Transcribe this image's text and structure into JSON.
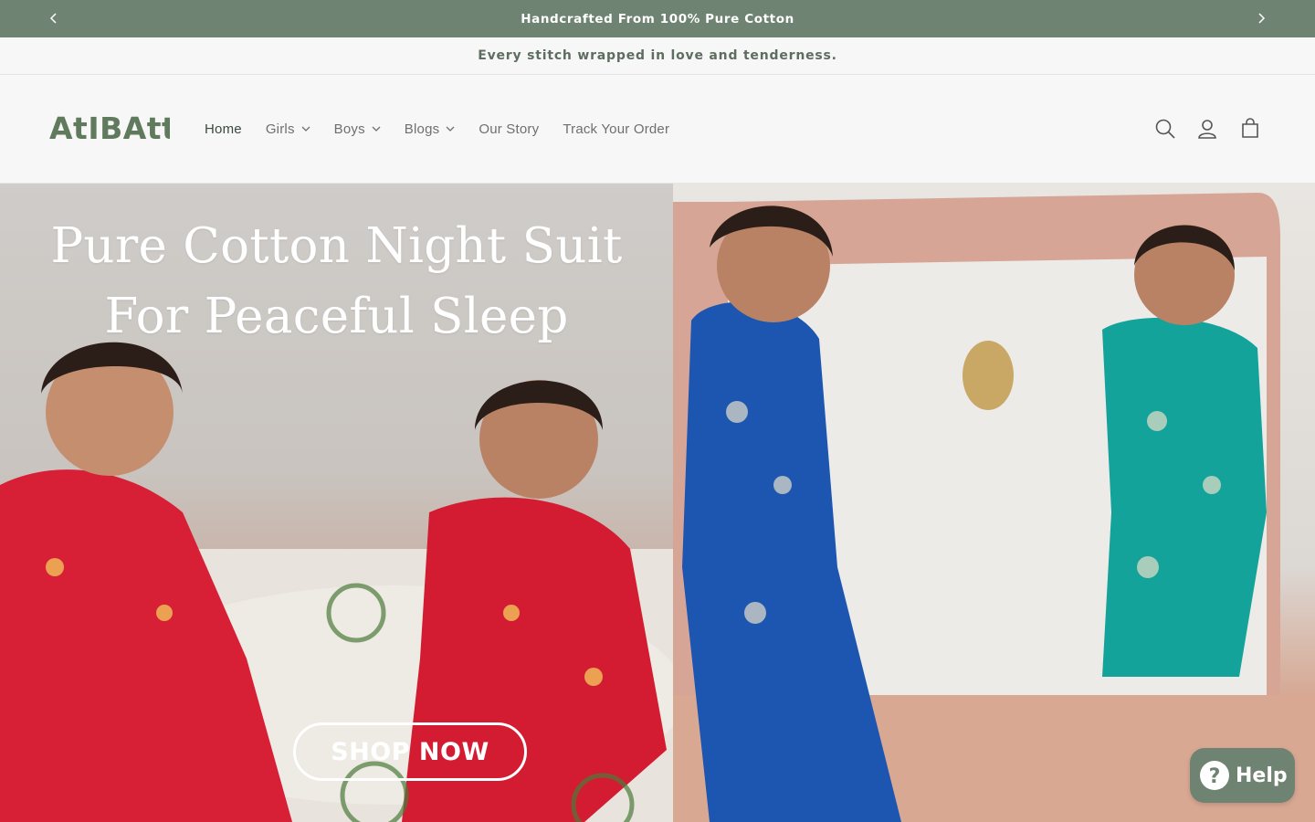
{
  "announcement": {
    "text": "Handcrafted From 100% Pure Cotton",
    "prev_icon": "chevron-left-icon",
    "next_icon": "chevron-right-icon"
  },
  "subbar": {
    "text": "Every stitch wrapped in love and tenderness."
  },
  "header": {
    "logo_text": "AtIBAtti",
    "nav": [
      {
        "label": "Home",
        "active": true,
        "dropdown": false
      },
      {
        "label": "Girls",
        "active": false,
        "dropdown": true
      },
      {
        "label": "Boys",
        "active": false,
        "dropdown": true
      },
      {
        "label": "Blogs",
        "active": false,
        "dropdown": true
      },
      {
        "label": "Our Story",
        "active": false,
        "dropdown": false
      },
      {
        "label": "Track Your Order",
        "active": false,
        "dropdown": false
      }
    ],
    "icons": [
      "search-icon",
      "account-icon",
      "cart-icon"
    ]
  },
  "hero": {
    "title_line1": "Pure Cotton Night Suit",
    "title_line2": "For Peaceful Sleep",
    "cta_label": "SHOP NOW"
  },
  "help_widget": {
    "label": "Help",
    "icon": "question-icon"
  },
  "colors": {
    "brand_green": "#6e8371",
    "logo_green": "#5f7a5c",
    "nav_text": "#6f6f6f"
  }
}
